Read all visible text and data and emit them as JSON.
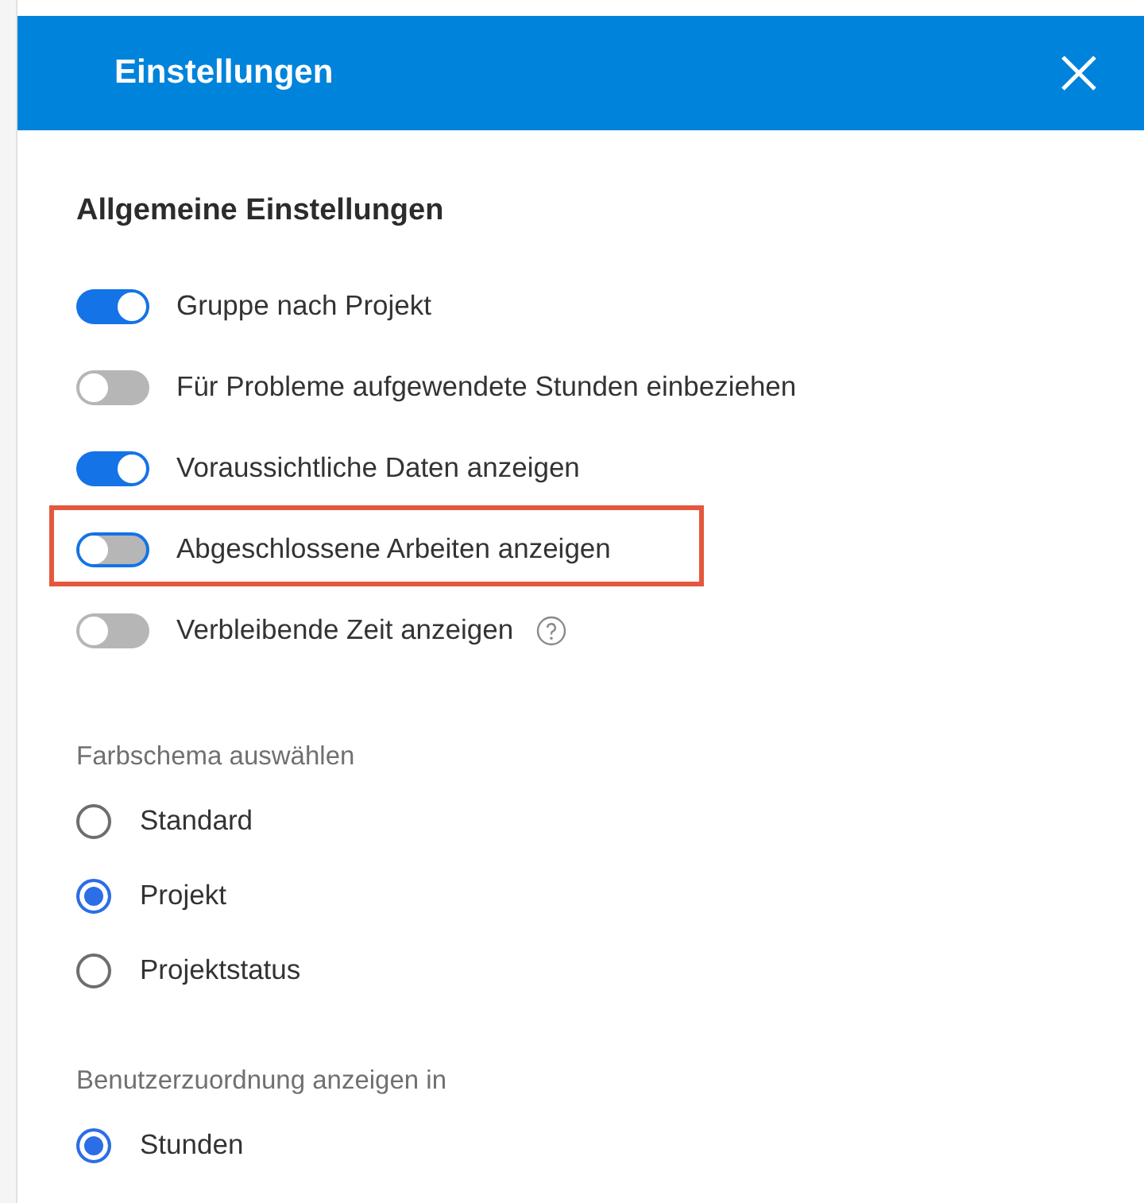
{
  "dialog": {
    "title": "Einstellungen"
  },
  "general": {
    "heading": "Allgemeine Einstellungen",
    "toggles": [
      {
        "label": "Gruppe nach Projekt",
        "on": true,
        "focused": false,
        "highlighted": false,
        "help": false
      },
      {
        "label": "Für Probleme aufgewendete Stunden einbeziehen",
        "on": false,
        "focused": false,
        "highlighted": false,
        "help": false
      },
      {
        "label": "Voraussichtliche Daten anzeigen",
        "on": true,
        "focused": false,
        "highlighted": false,
        "help": false
      },
      {
        "label": "Abgeschlossene Arbeiten anzeigen",
        "on": false,
        "focused": true,
        "highlighted": true,
        "help": false
      },
      {
        "label": "Verbleibende Zeit anzeigen",
        "on": false,
        "focused": false,
        "highlighted": false,
        "help": true
      }
    ]
  },
  "radio_groups": [
    {
      "label": "Farbschema auswählen",
      "options": [
        {
          "label": "Standard",
          "selected": false
        },
        {
          "label": "Projekt",
          "selected": true
        },
        {
          "label": "Projektstatus",
          "selected": false
        }
      ]
    },
    {
      "label": "Benutzerzuordnung anzeigen in",
      "options": [
        {
          "label": "Stunden",
          "selected": true
        }
      ]
    }
  ]
}
